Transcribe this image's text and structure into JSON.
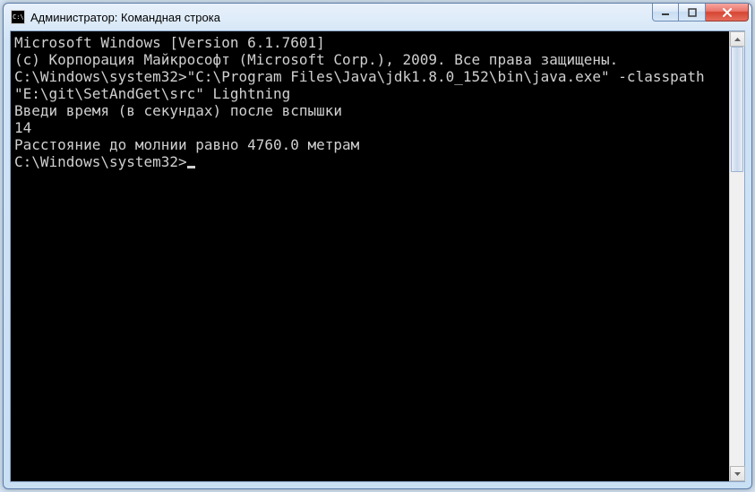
{
  "window": {
    "title": "Администратор: Командная строка"
  },
  "console": {
    "lines": [
      "Microsoft Windows [Version 6.1.7601]",
      "(c) Корпорация Майкрософт (Microsoft Corp.), 2009. Все права защищены.",
      "",
      "C:\\Windows\\system32>\"C:\\Program Files\\Java\\jdk1.8.0_152\\bin\\java.exe\" -classpath \"E:\\git\\SetAndGet\\src\" Lightning",
      "Введи время (в секундах) после вспышки",
      "14",
      "Расстояние до молнии равно 4760.0 метрам",
      ""
    ],
    "prompt": "C:\\Windows\\system32>"
  }
}
